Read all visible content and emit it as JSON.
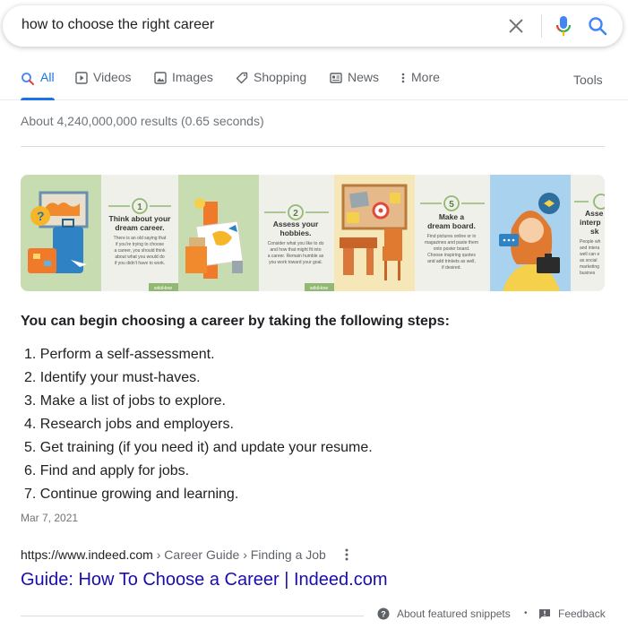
{
  "search": {
    "query": "how to choose the right career"
  },
  "tabs": [
    {
      "label": "All",
      "active": true,
      "icon": "search-icon"
    },
    {
      "label": "Videos",
      "icon": "video-icon"
    },
    {
      "label": "Images",
      "icon": "image-icon"
    },
    {
      "label": "Shopping",
      "icon": "tag-icon"
    },
    {
      "label": "News",
      "icon": "news-icon"
    },
    {
      "label": "More",
      "icon": "more-vert-icon"
    }
  ],
  "tools_label": "Tools",
  "stats": "About 4,240,000,000 results (0.65 seconds)",
  "carousel": {
    "panels": [
      {
        "number": "1",
        "title_lines": [
          "Think about your",
          "dream career."
        ],
        "body_lines": [
          "There is an old saying that",
          "if you're trying to choose",
          "a career, you should think",
          "about what you would do",
          "if you didn't have to work."
        ]
      },
      {
        "number": "2",
        "title_lines": [
          "Assess your",
          "hobbies."
        ],
        "body_lines": [
          "Consider what you like to do",
          "and how that might fit into",
          "a career. Remain humble as",
          "you work toward your goal."
        ]
      },
      {
        "number": "5",
        "title_lines": [
          "Make a",
          "dream board."
        ],
        "body_lines": [
          "Find pictures online or in",
          "magazines and paste them",
          "onto poster board.",
          "Choose inspiring quotes",
          "and add trinkets as well,",
          "if desired."
        ]
      },
      {
        "title_lines": [
          "Asse",
          "interp",
          "sk"
        ],
        "body_lines": [
          "People wh",
          "and intera",
          "well can e",
          "as social",
          "marketing",
          "busines"
        ]
      }
    ],
    "watermark": "wikiHow"
  },
  "snippet": {
    "heading": "You can begin choosing a career by taking the following steps:",
    "steps": [
      "1. Perform a self-assessment.",
      "2. Identify your must-haves.",
      "3. Make a list of jobs to explore.",
      "4. Research jobs and employers.",
      "5. Get training (if you need it) and update your resume.",
      "6. Find and apply for jobs.",
      "7. Continue growing and learning."
    ],
    "date": "Mar 7, 2021"
  },
  "result": {
    "url_domain": "https://www.indeed.com",
    "crumb_1": " › Career Guide",
    "crumb_2": " › Finding a Job",
    "title": "Guide: How To Choose a Career | Indeed.com"
  },
  "footer": {
    "about_label": "About featured snippets",
    "dot": "•",
    "feedback_label": "Feedback"
  },
  "colors": {
    "accent": "#1a73e8",
    "link": "#1a0dab",
    "wikihow_green": "#93b874"
  }
}
